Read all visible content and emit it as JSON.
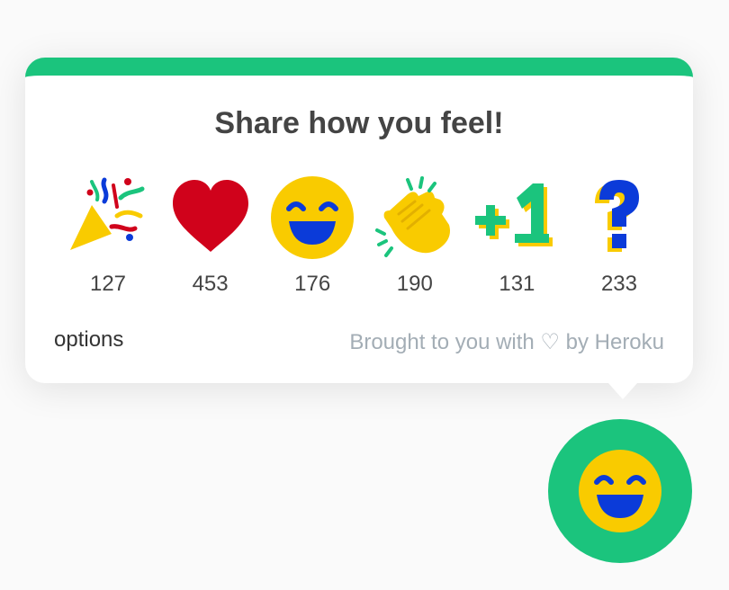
{
  "popup": {
    "title": "Share how you feel!",
    "accent_color": "#1bc47d",
    "reactions": [
      {
        "icon": "party-popper-icon",
        "count": "127"
      },
      {
        "icon": "heart-icon",
        "count": "453"
      },
      {
        "icon": "grinning-face-icon",
        "count": "176"
      },
      {
        "icon": "clapping-hands-icon",
        "count": "190"
      },
      {
        "icon": "plus-one-icon",
        "count": "131"
      },
      {
        "icon": "question-mark-icon",
        "count": "233"
      }
    ],
    "options_label": "options",
    "credit_text": "Brought to you with ♡ by Heroku"
  },
  "launcher": {
    "icon": "grinning-face-icon",
    "color": "#1bc47d"
  }
}
